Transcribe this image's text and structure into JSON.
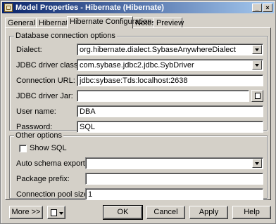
{
  "window": {
    "title": "Model Properties - Hibernate (Hibernate)",
    "minimize": "_",
    "close": "×"
  },
  "tabs": [
    "General",
    "Hibernate",
    "Hibernate Configuration",
    "Notes",
    "Preview"
  ],
  "active_tab": "Hibernate Configuration",
  "db_group": {
    "title": "Database connection options",
    "dialect_label": "Dialect:",
    "dialect_value": "org.hibernate.dialect.SybaseAnywhereDialect",
    "driver_class_label": "JDBC driver class:",
    "driver_class_value": "com.sybase.jdbc2.jdbc.SybDriver",
    "url_label": "Connection URL:",
    "url_value": "jdbc:sybase:Tds:localhost:2638",
    "driver_jar_label": "JDBC driver Jar:",
    "driver_jar_value": "",
    "username_label": "User name:",
    "username_value": "DBA",
    "password_label": "Password:",
    "password_value": "SQL"
  },
  "other_group": {
    "title": "Other options",
    "show_sql_label": "Show SQL",
    "show_sql_checked": false,
    "schema_export_label": "Auto schema export:",
    "schema_export_value": "",
    "package_prefix_label": "Package prefix:",
    "package_prefix_value": "",
    "pool_size_label": "Connection pool size:",
    "pool_size_value": "1"
  },
  "footer": {
    "more": "More >>",
    "ok": "OK",
    "cancel": "Cancel",
    "apply": "Apply",
    "help": "Help"
  }
}
